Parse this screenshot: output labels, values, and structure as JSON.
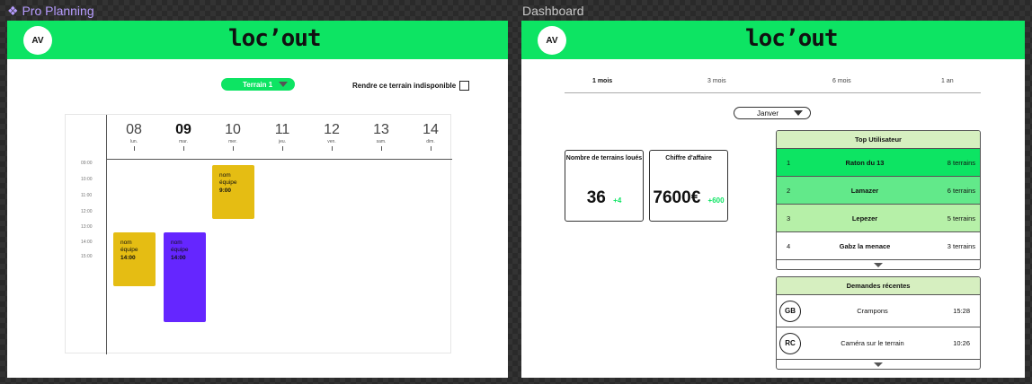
{
  "frames": {
    "planning_label": "Pro Planning",
    "dashboard_label": "Dashboard"
  },
  "app": {
    "logo": "loc’out",
    "avatar": "AV"
  },
  "planning": {
    "terrain_select": "Terrain 1",
    "unavailable_label": "Rendre ce terrain indisponible",
    "days": [
      {
        "num": "08",
        "label": "lun."
      },
      {
        "num": "09",
        "label": "mar."
      },
      {
        "num": "10",
        "label": "mer."
      },
      {
        "num": "11",
        "label": "jeu."
      },
      {
        "num": "12",
        "label": "ven."
      },
      {
        "num": "13",
        "label": "sam."
      },
      {
        "num": "14",
        "label": "dim."
      }
    ],
    "hours": [
      "09:00",
      "10:00",
      "11:00",
      "12:00",
      "13:00",
      "14:00",
      "15:00"
    ],
    "events": [
      {
        "name": "nom équipe",
        "time": "9:00"
      },
      {
        "name": "nom équipe",
        "time": "14:00"
      },
      {
        "name": "nom équipe",
        "time": "14:00"
      }
    ]
  },
  "dashboard": {
    "tabs": [
      "1 mois",
      "3 mois",
      "6 mois",
      "1 an"
    ],
    "month_select": "Janver",
    "stats": [
      {
        "title": "Nombre de terrains loués",
        "value": "36",
        "delta": "+4"
      },
      {
        "title": "Chiffre d'affaire",
        "value": "7600€",
        "delta": "+600"
      }
    ],
    "top_users": {
      "title": "Top Utilisateur",
      "rows": [
        {
          "rank": "1",
          "name": "Raton du 13",
          "count": "8 terrains",
          "color": "#0de463"
        },
        {
          "rank": "2",
          "name": "Lamazer",
          "count": "6 terrains",
          "color": "#62e98a"
        },
        {
          "rank": "3",
          "name": "Lepezer",
          "count": "5 terrains",
          "color": "#b6f0a8"
        },
        {
          "rank": "4",
          "name": "Gabz la menace",
          "count": "3 terrains",
          "color": "#ffffff"
        }
      ]
    },
    "requests": {
      "title": "Demandes récentes",
      "rows": [
        {
          "initials": "GB",
          "label": "Crampons",
          "time": "15:28"
        },
        {
          "initials": "RC",
          "label": "Caméra sur le terrain",
          "time": "10:26"
        }
      ]
    }
  },
  "colors": {
    "brand_green": "#0de463",
    "event_yellow": "#e5bd13",
    "event_purple": "#6526ff"
  }
}
